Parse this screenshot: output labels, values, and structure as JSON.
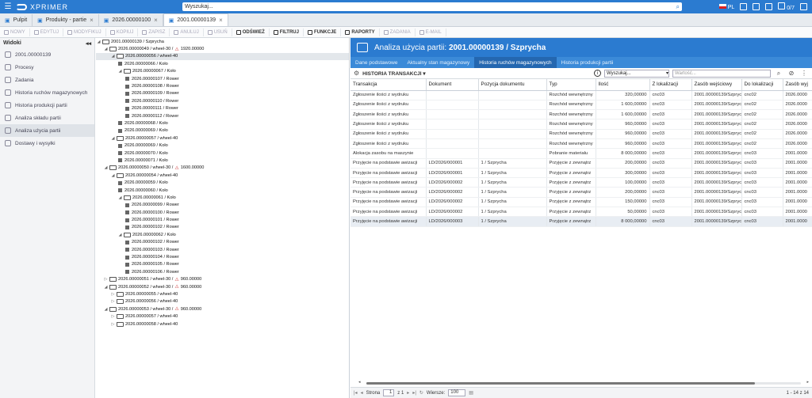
{
  "app": {
    "name": "XPRIMER",
    "search_placeholder": "Wyszukaj...",
    "lang": "PL",
    "counter": "0/7"
  },
  "tabs": [
    {
      "label": "Pulpit",
      "icon": "home-icon"
    },
    {
      "label": "Produkty - partie",
      "icon": "box-icon"
    },
    {
      "label": "2026.00000100",
      "icon": "document-icon"
    },
    {
      "label": "2001.00000139",
      "icon": "filter-icon",
      "active": true
    }
  ],
  "toolbar": [
    "NOWY",
    "EDYTUJ",
    "MODYFIKUJ",
    "KOPIUJ",
    "ZAPISZ",
    "ANULUJ",
    "USUŃ",
    "ODŚWIEŻ",
    "FILTRUJ",
    "FUNKCJE",
    "RAPORTY",
    "ZADANIA",
    "E-MAIL"
  ],
  "sidebar": {
    "title": "Widoki",
    "items": [
      {
        "label": "2001.00000139"
      },
      {
        "label": "Procesy"
      },
      {
        "label": "Zadania"
      },
      {
        "label": "Historia ruchów magazynowych"
      },
      {
        "label": "Historia produkcji partii"
      },
      {
        "label": "Analiza składu partii"
      },
      {
        "label": "Analiza użycia partii",
        "selected": true
      },
      {
        "label": "Dostawy i wysyłki"
      }
    ]
  },
  "tree": [
    {
      "d": 0,
      "t": "2001.00000139 / Szprycha",
      "k": "f",
      "o": true
    },
    {
      "d": 1,
      "t": "2026.00000049 / wheel-30 /",
      "k": "f",
      "o": true,
      "w": "1920.00000"
    },
    {
      "d": 2,
      "t": "2026.00000056 / wheel-40",
      "k": "f",
      "o": true,
      "s": true
    },
    {
      "d": 3,
      "t": "2026.00000066 / Koło",
      "k": "s"
    },
    {
      "d": 3,
      "t": "2026.00000067 / Koło",
      "k": "f",
      "o": true
    },
    {
      "d": 4,
      "t": "2026.00000107 / Rower",
      "k": "s"
    },
    {
      "d": 4,
      "t": "2026.00000108 / Rower",
      "k": "s"
    },
    {
      "d": 4,
      "t": "2026.00000109 / Rower",
      "k": "s"
    },
    {
      "d": 4,
      "t": "2026.00000110 / Rower",
      "k": "s"
    },
    {
      "d": 4,
      "t": "2026.00000111 / Rower",
      "k": "s"
    },
    {
      "d": 4,
      "t": "2026.00000112 / Rower",
      "k": "s"
    },
    {
      "d": 3,
      "t": "2026.00000068 / Koło",
      "k": "s"
    },
    {
      "d": 3,
      "t": "2026.00000069 / Koło",
      "k": "s"
    },
    {
      "d": 2,
      "t": "2026.00000057 / wheel-40",
      "k": "f",
      "o": true
    },
    {
      "d": 3,
      "t": "2026.00000069 / Koło",
      "k": "s"
    },
    {
      "d": 3,
      "t": "2026.00000070 / Koło",
      "k": "s"
    },
    {
      "d": 3,
      "t": "2026.00000071 / Koło",
      "k": "s"
    },
    {
      "d": 1,
      "t": "2026.00000050 / wheel-30 /",
      "k": "f",
      "o": true,
      "w": "1600.00000"
    },
    {
      "d": 2,
      "t": "2026.00000054 / wheel-40",
      "k": "f",
      "o": true
    },
    {
      "d": 3,
      "t": "2026.00000059 / Koło",
      "k": "s"
    },
    {
      "d": 3,
      "t": "2026.00000060 / Koło",
      "k": "s"
    },
    {
      "d": 3,
      "t": "2026.00000061 / Koło",
      "k": "f",
      "o": true
    },
    {
      "d": 4,
      "t": "2026.00000099 / Rower",
      "k": "s"
    },
    {
      "d": 4,
      "t": "2026.00000100 / Rower",
      "k": "s"
    },
    {
      "d": 4,
      "t": "2026.00000101 / Rower",
      "k": "s"
    },
    {
      "d": 4,
      "t": "2026.00000102 / Rower",
      "k": "s"
    },
    {
      "d": 3,
      "t": "2026.00000062 / Koło",
      "k": "f",
      "o": true
    },
    {
      "d": 4,
      "t": "2026.00000102 / Rower",
      "k": "s"
    },
    {
      "d": 4,
      "t": "2026.00000103 / Rower",
      "k": "s"
    },
    {
      "d": 4,
      "t": "2026.00000104 / Rower",
      "k": "s"
    },
    {
      "d": 4,
      "t": "2026.00000105 / Rower",
      "k": "s"
    },
    {
      "d": 4,
      "t": "2026.00000106 / Rower",
      "k": "s"
    },
    {
      "d": 1,
      "t": "2026.00000051 / wheel-30 /",
      "k": "f",
      "o": false,
      "w": "960.00000"
    },
    {
      "d": 1,
      "t": "2026.00000052 / wheel-30 /",
      "k": "f",
      "o": true,
      "w": "960.00000"
    },
    {
      "d": 2,
      "t": "2026.00000055 / wheel-40",
      "k": "f",
      "o": false
    },
    {
      "d": 2,
      "t": "2026.00000056 / wheel-40",
      "k": "f",
      "o": false
    },
    {
      "d": 1,
      "t": "2026.00000053 / wheel-30 /",
      "k": "f",
      "o": true,
      "w": "960.00000"
    },
    {
      "d": 2,
      "t": "2026.00000057 / wheel-40",
      "k": "f",
      "o": false
    },
    {
      "d": 2,
      "t": "2026.00000058 / wheel-40",
      "k": "f",
      "o": false
    }
  ],
  "panel": {
    "title_prefix": "Analiza użycia partii: ",
    "title_bold": "2001.00000139 / Szprycha",
    "tabs": [
      "Dane podstawowe",
      "Aktualny stan magazynowy",
      "Historia ruchów magazynowych",
      "Historia produkcji partii"
    ],
    "active_tab": 2,
    "grid_label": "HISTORIA TRANSAKCJI",
    "search_select": "Wyszukaj...",
    "value_placeholder": "Wartość..."
  },
  "grid": {
    "columns": [
      "Transakcja",
      "Dokument",
      "Pozycja dokumentu",
      "Typ",
      "Ilość",
      "Z lokalizacji",
      "Zasób wejściowy",
      "Do lokalizacji",
      "Zasób wyj"
    ],
    "rows": [
      [
        "Zgłoszenie ilości z wydruku",
        "",
        "",
        "Rozchód wewnętrzny",
        "320,00000",
        "cnc03",
        "2001.00000139/Szprycha",
        "cnc02",
        "2026.0000"
      ],
      [
        "Zgłoszenie ilości z wydruku",
        "",
        "",
        "Rozchód wewnętrzny",
        "1 600,00000",
        "cnc03",
        "2001.00000139/Szprycha",
        "cnc02",
        "2026.0000"
      ],
      [
        "Zgłoszenie ilości z wydruku",
        "",
        "",
        "Rozchód wewnętrzny",
        "1 600,00000",
        "cnc03",
        "2001.00000139/Szprycha",
        "cnc02",
        "2026.0000"
      ],
      [
        "Zgłoszenie ilości z wydruku",
        "",
        "",
        "Rozchód wewnętrzny",
        "960,00000",
        "cnc03",
        "2001.00000139/Szprycha",
        "cnc02",
        "2026.0000"
      ],
      [
        "Zgłoszenie ilości z wydruku",
        "",
        "",
        "Rozchód wewnętrzny",
        "960,00000",
        "cnc03",
        "2001.00000139/Szprycha",
        "cnc02",
        "2026.0000"
      ],
      [
        "Zgłoszenie ilości z wydruku",
        "",
        "",
        "Rozchód wewnętrzny",
        "960,00000",
        "cnc03",
        "2001.00000139/Szprycha",
        "cnc02",
        "2026.0000"
      ],
      [
        "Alokacja zasobu na maszynie",
        "",
        "",
        "Pobranie materiału",
        "8 000,00000",
        "cnc03",
        "2001.00000139/Szprycha",
        "cnc03",
        "2001.0000"
      ],
      [
        "Przyjęcie na podstawie awizacji",
        "LD/2026/000001",
        "1 / Szprycha",
        "Przyjęcie z zewnątrz",
        "200,00000",
        "cnc03",
        "2001.00000139/Szprycha",
        "cnc03",
        "2001.0000"
      ],
      [
        "Przyjęcie na podstawie awizacji",
        "LD/2026/000001",
        "1 / Szprycha",
        "Przyjęcie z zewnątrz",
        "300,00000",
        "cnc03",
        "2001.00000139/Szprycha",
        "cnc03",
        "2001.0000"
      ],
      [
        "Przyjęcie na podstawie awizacji",
        "LD/2026/000002",
        "1 / Szprycha",
        "Przyjęcie z zewnątrz",
        "100,00000",
        "cnc03",
        "2001.00000139/Szprycha",
        "cnc03",
        "2001.0000"
      ],
      [
        "Przyjęcie na podstawie awizacji",
        "LD/2026/000002",
        "1 / Szprycha",
        "Przyjęcie z zewnątrz",
        "200,00000",
        "cnc03",
        "2001.00000139/Szprycha",
        "cnc03",
        "2001.0000"
      ],
      [
        "Przyjęcie na podstawie awizacji",
        "LD/2026/000002",
        "1 / Szprycha",
        "Przyjęcie z zewnątrz",
        "150,00000",
        "cnc03",
        "2001.00000139/Szprycha",
        "cnc03",
        "2001.0000"
      ],
      [
        "Przyjęcie na podstawie awizacji",
        "LD/2026/000002",
        "1 / Szprycha",
        "Przyjęcie z zewnątrz",
        "50,00000",
        "cnc03",
        "2001.00000139/Szprycha",
        "cnc03",
        "2001.0000"
      ],
      [
        "Przyjęcie na podstawie awizacji",
        "LD/2026/000003",
        "1 / Szprycha",
        "Przyjęcie z zewnątrz",
        "8 000,00000",
        "cnc03",
        "2001.00000139/Szprycha",
        "cnc03",
        "2001.0000"
      ]
    ],
    "selected_row": 13
  },
  "pager": {
    "page_label": "Strona",
    "page": "1",
    "of": "z 1",
    "rows_label": "Wiersze:",
    "rows": "100",
    "range": "1 - 14 z 14"
  }
}
